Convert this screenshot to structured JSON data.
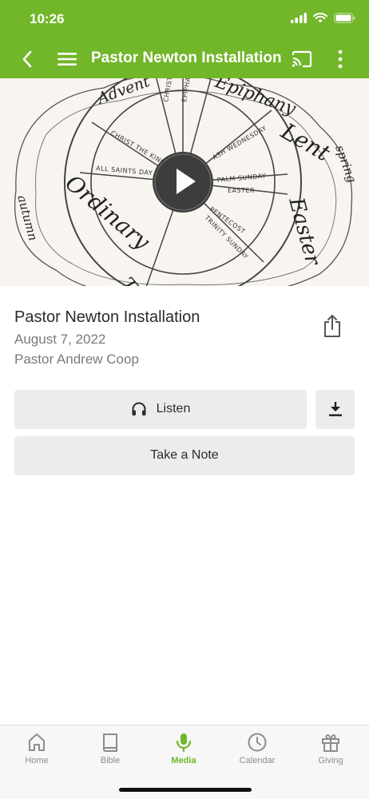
{
  "status_bar": {
    "time": "10:26"
  },
  "app_bar": {
    "title": "Pastor Newton Installation"
  },
  "hero": {
    "wheel_labels": {
      "advent": "Advent",
      "epiphany": "Epiphany",
      "lent": "Lent",
      "easter": "Easter",
      "ordinary": "Ordinary",
      "ordinary_time_fragment": "Ti",
      "christmas": "CHRISTMAS",
      "epiphany_small": "EPIPHANY",
      "christ_the_king": "CHRIST THE KING",
      "all_saints_day": "ALL SAINTS DAY",
      "ash_wednesday": "ASH WEDNESDAY",
      "palm_sunday": "PALM SUNDAY",
      "easter_small": "EASTER",
      "pentecost": "PENTECOST",
      "trinity_sunday": "TRINITY SUNDAY",
      "spring": "spring",
      "autumn": "autumn"
    }
  },
  "sermon": {
    "title": "Pastor Newton Installation",
    "date": "August 7, 2022",
    "speaker": "Pastor Andrew Coop"
  },
  "actions": {
    "listen_label": "Listen",
    "take_note_label": "Take a Note"
  },
  "tabs": [
    {
      "label": "Home",
      "icon": "home-icon"
    },
    {
      "label": "Bible",
      "icon": "book-icon"
    },
    {
      "label": "Media",
      "icon": "microphone-icon",
      "active": true
    },
    {
      "label": "Calendar",
      "icon": "clock-icon"
    },
    {
      "label": "Giving",
      "icon": "gift-icon"
    }
  ],
  "colors": {
    "brand_green": "#72b62a",
    "button_gray": "#ececee"
  }
}
